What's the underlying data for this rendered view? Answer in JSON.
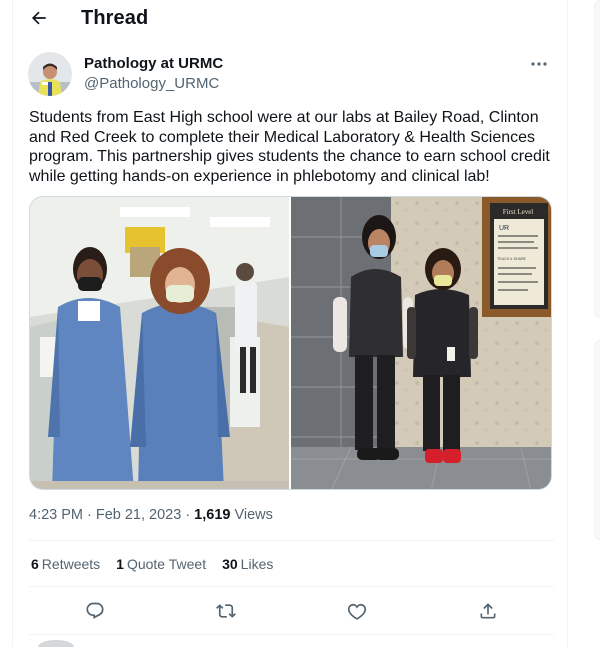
{
  "header": {
    "title": "Thread"
  },
  "tweet": {
    "author_name": "Pathology at URMC",
    "author_handle": "@Pathology_URMC",
    "text": "Students from East High school were at our labs at Bailey Road, Clinton and Red Creek to complete their Medical Laboratory & Health Sciences program. This partnership gives students the chance to earn school credit while getting hands-on experience in phlebotomy and clinical lab!",
    "time": "4:23 PM",
    "date": "Feb 21, 2023",
    "separator_1": "·",
    "separator_2": "·",
    "views_count": "1,619",
    "views_label": "Views"
  },
  "stats": {
    "retweets_count": "6",
    "retweets_label": "Retweets",
    "quotes_count": "1",
    "quotes_label": "Quote Tweet",
    "likes_count": "30",
    "likes_label": "Likes"
  },
  "photo2_sign": {
    "line1": "First Level",
    "line2": "UR",
    "line3": "TEACH & SHARE"
  },
  "colors": {
    "text_primary": "#0f1419",
    "text_secondary": "#536471",
    "border": "#eff3f4",
    "gown_blue": "#5f86c0"
  },
  "icons": [
    "back-arrow-icon",
    "more-icon",
    "reply-icon",
    "retweet-icon",
    "like-icon",
    "share-icon"
  ]
}
